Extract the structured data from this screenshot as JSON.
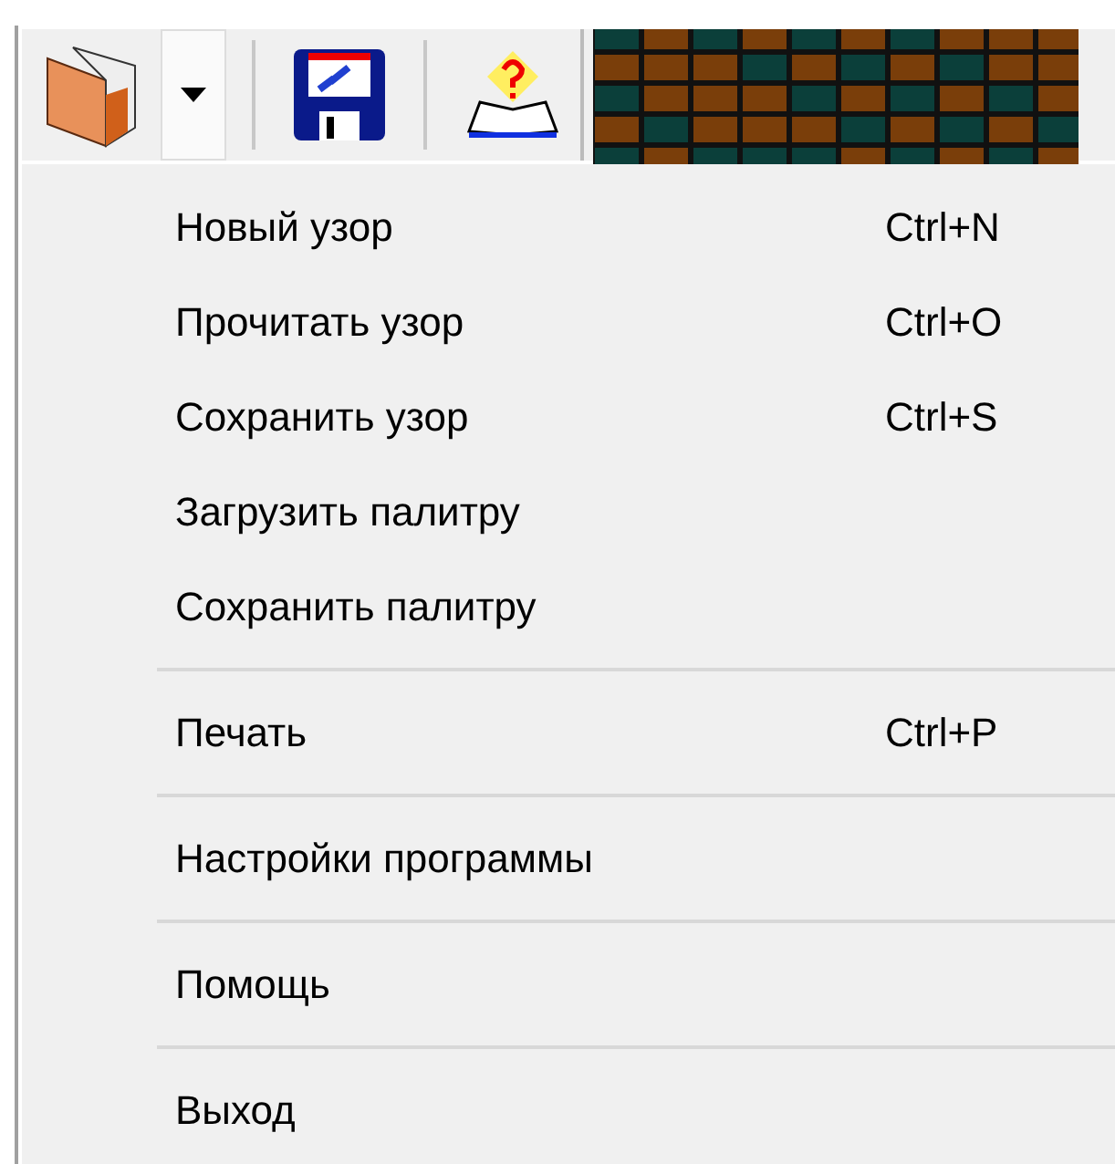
{
  "menu": {
    "items": [
      {
        "kind": "item",
        "label": "Новый узор",
        "shortcut": "Ctrl+N"
      },
      {
        "kind": "item",
        "label": "Прочитать узор",
        "shortcut": "Ctrl+O"
      },
      {
        "kind": "item",
        "label": "Сохранить узор",
        "shortcut": "Ctrl+S"
      },
      {
        "kind": "item",
        "label": "Загрузить палитру"
      },
      {
        "kind": "item",
        "label": "Сохранить палитру"
      },
      {
        "kind": "separator"
      },
      {
        "kind": "item",
        "label": "Печать",
        "shortcut": "Ctrl+P"
      },
      {
        "kind": "separator"
      },
      {
        "kind": "item",
        "label": "Настройки программы"
      },
      {
        "kind": "separator"
      },
      {
        "kind": "item",
        "label": "Помощь"
      },
      {
        "kind": "separator"
      },
      {
        "kind": "item",
        "label": "Выход"
      }
    ]
  }
}
